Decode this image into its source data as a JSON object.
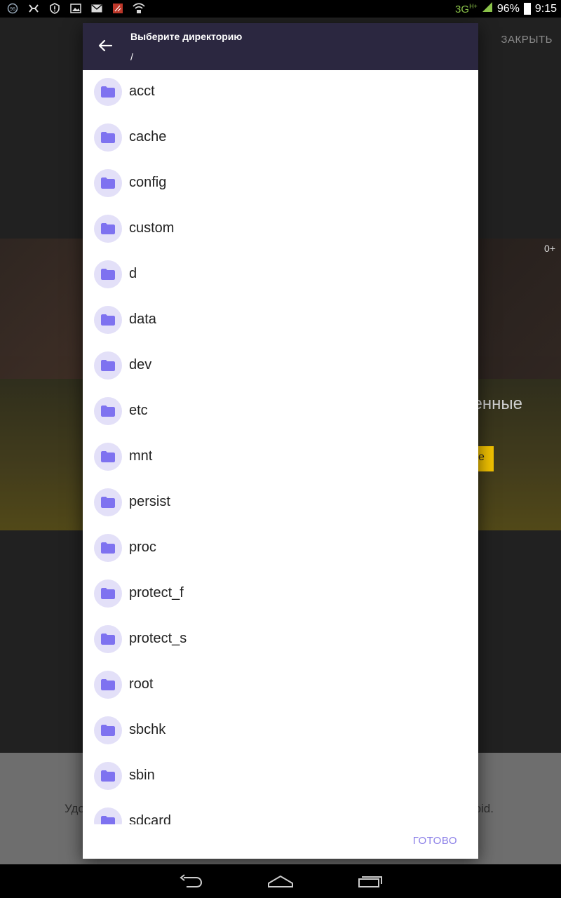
{
  "status_bar": {
    "left_icons": [
      "notification-badge-icon",
      "app-notification-icon",
      "shield-alert-icon",
      "image-icon",
      "mail-icon",
      "app-red-icon",
      "wifi-lock-icon"
    ],
    "network": "3G",
    "network_superscript": "H+",
    "battery": "96%",
    "time": "9:15"
  },
  "background_app": {
    "close_label": "ЗАКРЫТЬ",
    "age_badge": "0+",
    "banner_text": "енные",
    "button_text": "е",
    "footer_left": "Удо",
    "footer_right": "oid.",
    "colors": {
      "button": "#f2c200"
    }
  },
  "dialog": {
    "title": "Выберите директорию",
    "path": "/",
    "items": [
      {
        "label": "acct"
      },
      {
        "label": "cache"
      },
      {
        "label": "config"
      },
      {
        "label": "custom"
      },
      {
        "label": "d"
      },
      {
        "label": "data"
      },
      {
        "label": "dev"
      },
      {
        "label": "etc"
      },
      {
        "label": "mnt"
      },
      {
        "label": "persist"
      },
      {
        "label": "proc"
      },
      {
        "label": "protect_f"
      },
      {
        "label": "protect_s"
      },
      {
        "label": "root"
      },
      {
        "label": "sbchk"
      },
      {
        "label": "sbin"
      },
      {
        "label": "sdcard"
      }
    ],
    "done_label": "ГОТОВО",
    "colors": {
      "header": "#2b2740",
      "accent": "#8c80e8",
      "folder_icon": "#7e72f0",
      "folder_bg": "#e3e0f8"
    }
  },
  "nav_bar": {
    "buttons": [
      "back-nav-icon",
      "home-nav-icon",
      "recents-nav-icon"
    ]
  }
}
